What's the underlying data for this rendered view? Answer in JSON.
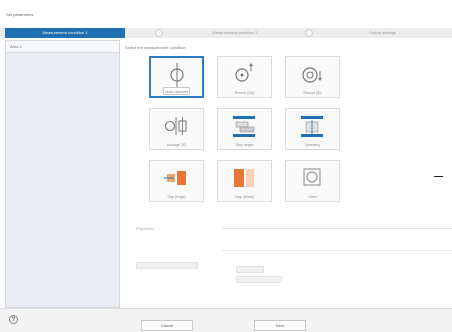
{
  "window": {
    "title": "Set parameters"
  },
  "wizard": {
    "steps": [
      {
        "label": "Measurement condition 1"
      },
      {
        "label": "Measurement condition 2"
      },
      {
        "label": "Output settings"
      }
    ]
  },
  "sidebar": {
    "items": [
      {
        "label": "Area 1"
      }
    ]
  },
  "main": {
    "prompt": "Select the measurement condition",
    "tiles": [
      {
        "label": "Outer diameter",
        "icon": "outer-diameter-icon",
        "selected": true
      },
      {
        "label": "Runout (OD)",
        "icon": "runout-od-icon"
      },
      {
        "label": "Runout (ID)",
        "icon": "runout-id-icon"
      },
      {
        "label": "Average OD",
        "icon": "average-od-icon"
      },
      {
        "label": "Step height",
        "icon": "step-height-icon"
      },
      {
        "label": "Symmetry",
        "icon": "symmetry-icon"
      },
      {
        "label": "Gap (Edge)",
        "icon": "gap-edge-icon"
      },
      {
        "label": "Gap (Width)",
        "icon": "gap-width-icon"
      },
      {
        "label": "Other",
        "icon": "other-icon"
      }
    ],
    "properties": {
      "title": "Properties"
    }
  },
  "footer": {
    "cancel_label": "Cancel",
    "next_label": "Next",
    "help_symbol": "?"
  }
}
